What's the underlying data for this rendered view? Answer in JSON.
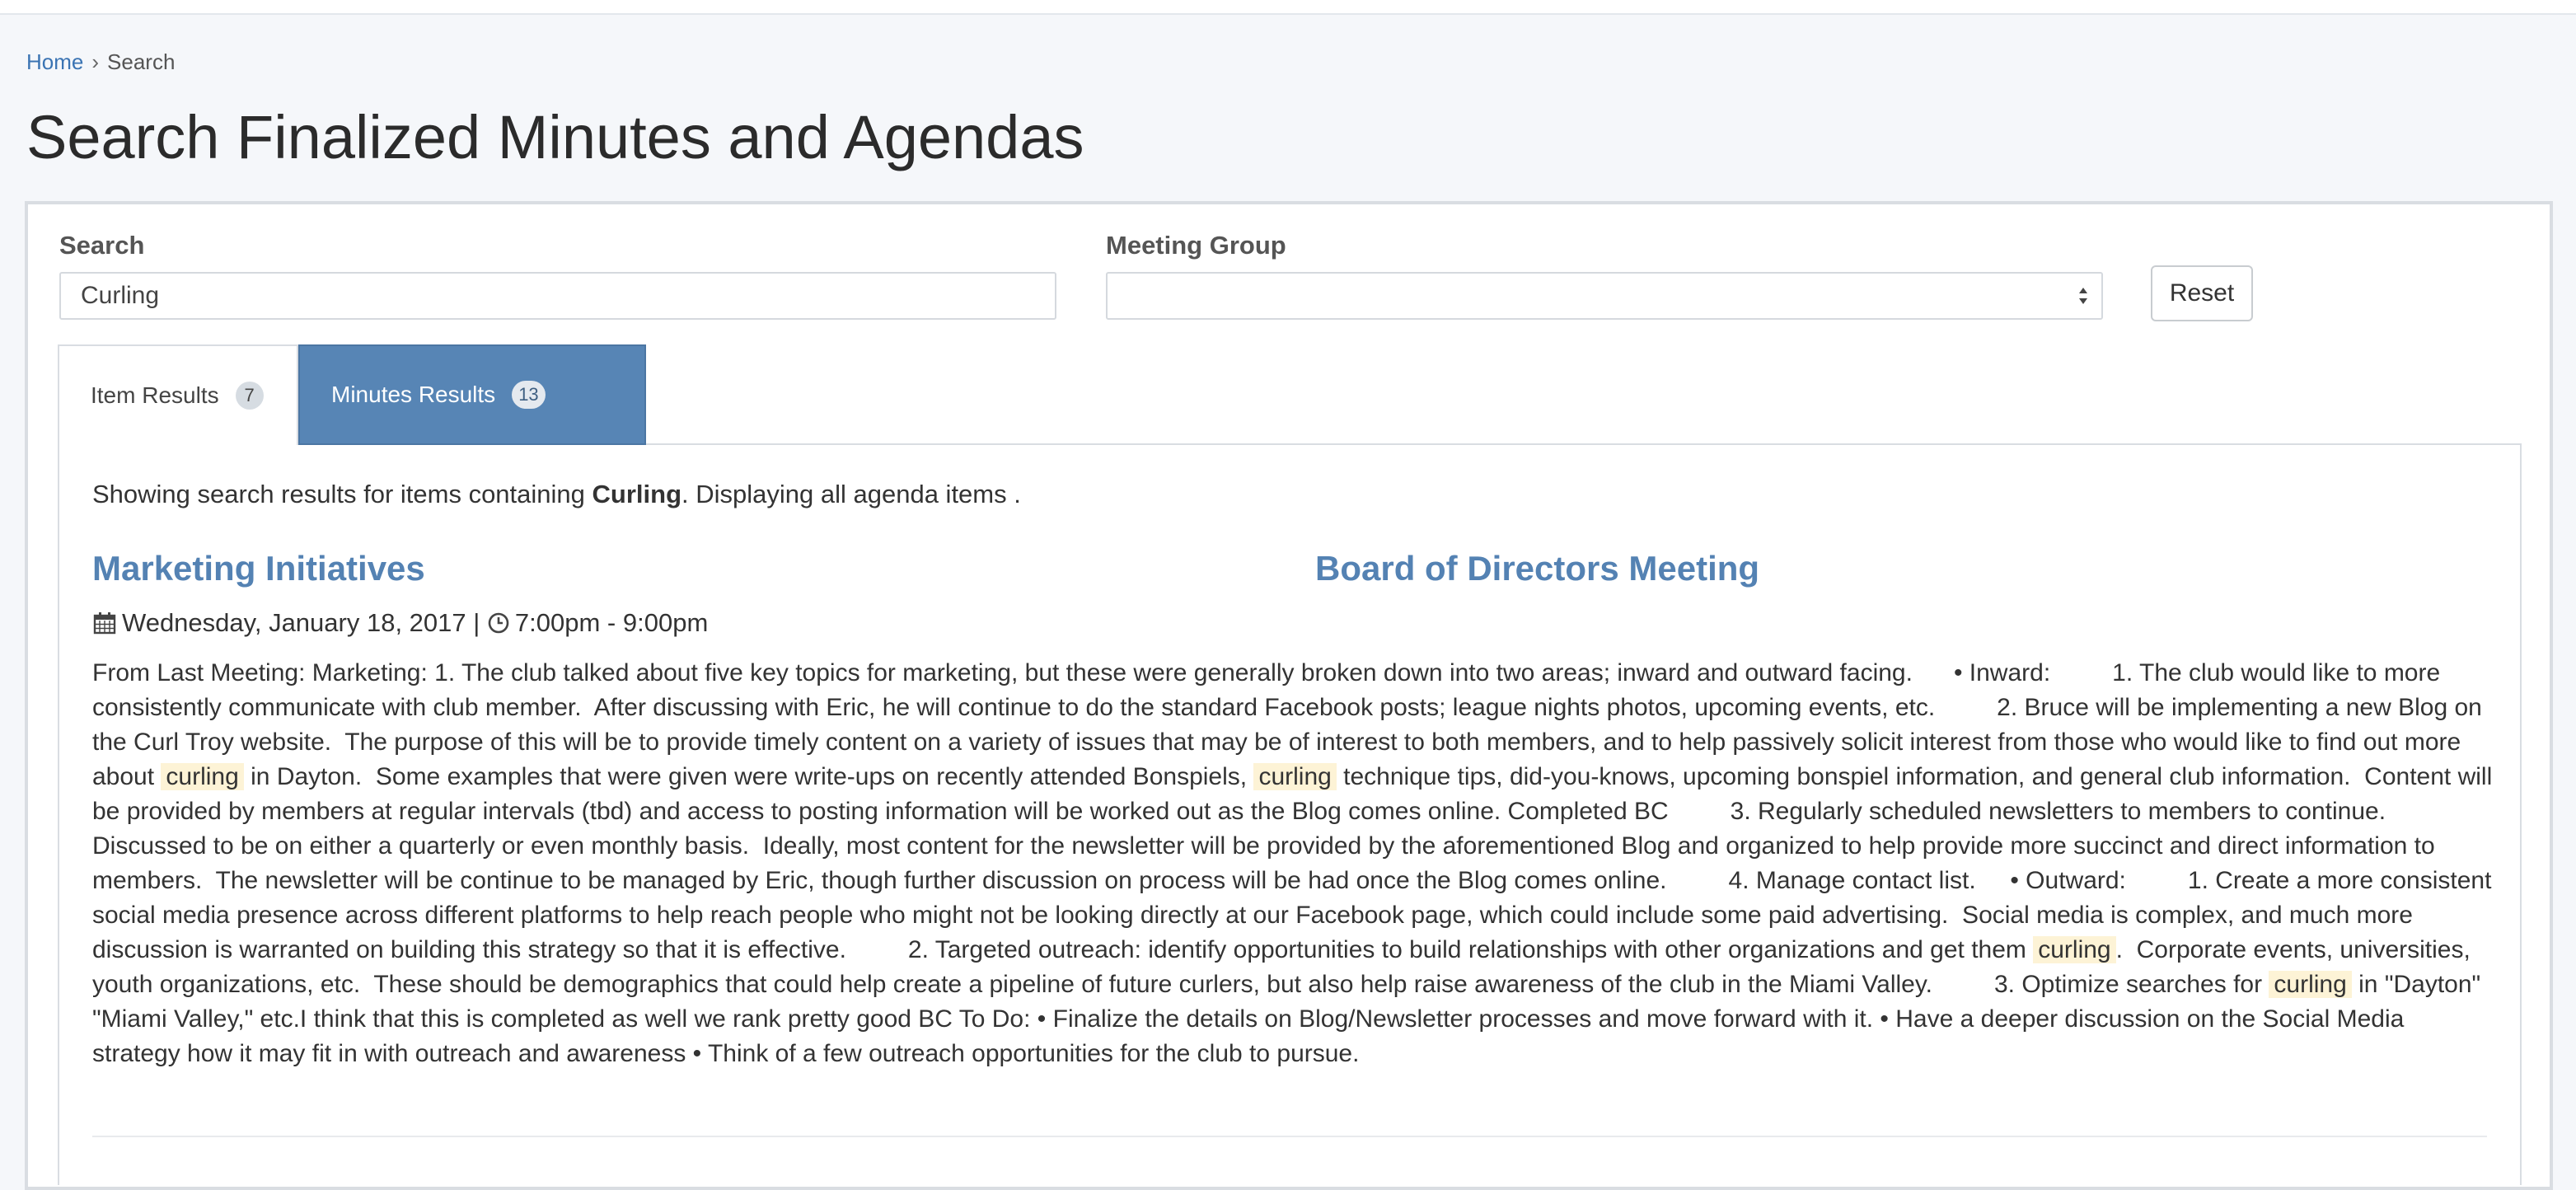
{
  "breadcrumb": {
    "home": "Home",
    "separator": "›",
    "current": "Search"
  },
  "page_title": "Search Finalized Minutes and Agendas",
  "search": {
    "label": "Search",
    "value": "Curling"
  },
  "meeting_group": {
    "label": "Meeting Group",
    "value": ""
  },
  "reset_label": "Reset",
  "tabs": [
    {
      "label": "Item Results",
      "count": "7",
      "active": false
    },
    {
      "label": "Minutes Results",
      "count": "13",
      "active": true
    }
  ],
  "summary": {
    "prefix": "Showing search results for items containing ",
    "term": "Curling",
    "suffix": ". Displaying all agenda items ."
  },
  "result": {
    "title": "Marketing Initiatives",
    "meeting": "Board of Directors Meeting",
    "date": "Wednesday, January 18, 2017",
    "divider": " | ",
    "time": "7:00pm - 9:00pm",
    "body_segments": [
      {
        "text": "From Last Meeting: Marketing: 1. The club talked about five key topics for marketing, but these were generally broken down into two areas; inward and outward facing.      • Inward:         1. The club would like to more consistently communicate with club member.  After discussing with Eric, he will continue to do the standard Facebook posts; league nights photos, upcoming events, etc.         2. Bruce will be implementing a new Blog on the Curl Troy website.  The purpose of this will be to provide timely content on a variety of issues that may be of interest to both members, and to help passively solicit interest from those who would like to find out more about ",
        "hl": false
      },
      {
        "text": "curling",
        "hl": true
      },
      {
        "text": " in Dayton.  Some examples that were given were write-ups on recently attended Bonspiels, ",
        "hl": false
      },
      {
        "text": "curling",
        "hl": true
      },
      {
        "text": " technique tips, did-you-knows, upcoming bonspiel information, and general club information.  Content will be provided by members at regular intervals (tbd) and access to posting information will be worked out as the Blog comes online. Completed BC         3. Regularly scheduled newsletters to members to continue.  Discussed to be on either a quarterly or even monthly basis.  Ideally, most content for the newsletter will be provided by the aforementioned Blog and organized to help provide more succinct and direct information to members.  The newsletter will be continue to be managed by Eric, though further discussion on process will be had once the Blog comes online.         4. Manage contact list.     • Outward:         1. Create a more consistent social media presence across different platforms to help reach people who might not be looking directly at our Facebook page, which could include some paid advertising.  Social media is complex, and much more discussion is warranted on building this strategy so that it is effective.         2. Targeted outreach: identify opportunities to build relationships with other organizations and get them ",
        "hl": false
      },
      {
        "text": "curling",
        "hl": true
      },
      {
        "text": ".  Corporate events, universities, youth organizations, etc.  These should be demographics that could help create a pipeline of future curlers, but also help raise awareness of the club in the Miami Valley.         3. Optimize searches for ",
        "hl": false
      },
      {
        "text": "curling",
        "hl": true
      },
      {
        "text": " in \"Dayton\" \"Miami Valley,\" etc.I think that this is completed as well we rank pretty good BC To Do: • Finalize the details on Blog/Newsletter processes and move forward with it. • Have a deeper discussion on the Social Media strategy how it may fit in with outreach and awareness • Think of a few outreach opportunities for the club to pursue.",
        "hl": false
      }
    ]
  },
  "colors": {
    "accent": "#5785b5",
    "link": "#3b74b3",
    "highlight": "#fdf3d6"
  },
  "icons": {
    "date": "calendar-icon",
    "time": "clock-icon",
    "select": "select-arrows-icon"
  }
}
